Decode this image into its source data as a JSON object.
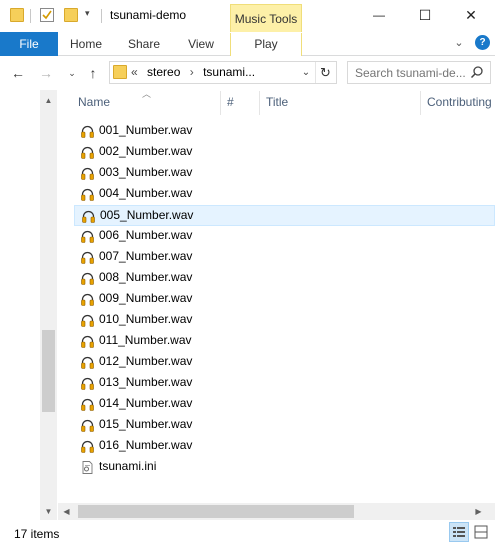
{
  "window": {
    "title": "tsunami-demo",
    "minimize_glyph": "—",
    "maximize_glyph": "☐",
    "close_glyph": "✕"
  },
  "ribbon": {
    "contextual_group": "Music Tools",
    "file_tab": "File",
    "tabs": [
      "Home",
      "Share",
      "View"
    ],
    "contextual_tab": "Play",
    "help_glyph": "?"
  },
  "address": {
    "overflow": "«",
    "crumbs": [
      "stereo",
      "tsunami..."
    ],
    "search_placeholder": "Search tsunami-de..."
  },
  "columns": {
    "name": "Name",
    "number": "#",
    "title": "Title",
    "contributing": "Contributing"
  },
  "files": [
    {
      "name": "001_Number.wav",
      "type": "audio-file-icon"
    },
    {
      "name": "002_Number.wav",
      "type": "audio-file-icon"
    },
    {
      "name": "003_Number.wav",
      "type": "audio-file-icon"
    },
    {
      "name": "004_Number.wav",
      "type": "audio-file-icon"
    },
    {
      "name": "005_Number.wav",
      "type": "audio-file-icon",
      "selected": true
    },
    {
      "name": "006_Number.wav",
      "type": "audio-file-icon"
    },
    {
      "name": "007_Number.wav",
      "type": "audio-file-icon"
    },
    {
      "name": "008_Number.wav",
      "type": "audio-file-icon"
    },
    {
      "name": "009_Number.wav",
      "type": "audio-file-icon"
    },
    {
      "name": "010_Number.wav",
      "type": "audio-file-icon"
    },
    {
      "name": "011_Number.wav",
      "type": "audio-file-icon"
    },
    {
      "name": "012_Number.wav",
      "type": "audio-file-icon"
    },
    {
      "name": "013_Number.wav",
      "type": "audio-file-icon"
    },
    {
      "name": "014_Number.wav",
      "type": "audio-file-icon"
    },
    {
      "name": "015_Number.wav",
      "type": "audio-file-icon"
    },
    {
      "name": "016_Number.wav",
      "type": "audio-file-icon"
    },
    {
      "name": "tsunami.ini",
      "type": "settings-file-icon"
    }
  ],
  "status": {
    "item_count": "17 items"
  },
  "colors": {
    "accent": "#1979ca",
    "selection": "#e5f3ff",
    "contextual": "#fdf0a8",
    "folder": "#f6cf5a",
    "headphones": "#e8a200"
  }
}
